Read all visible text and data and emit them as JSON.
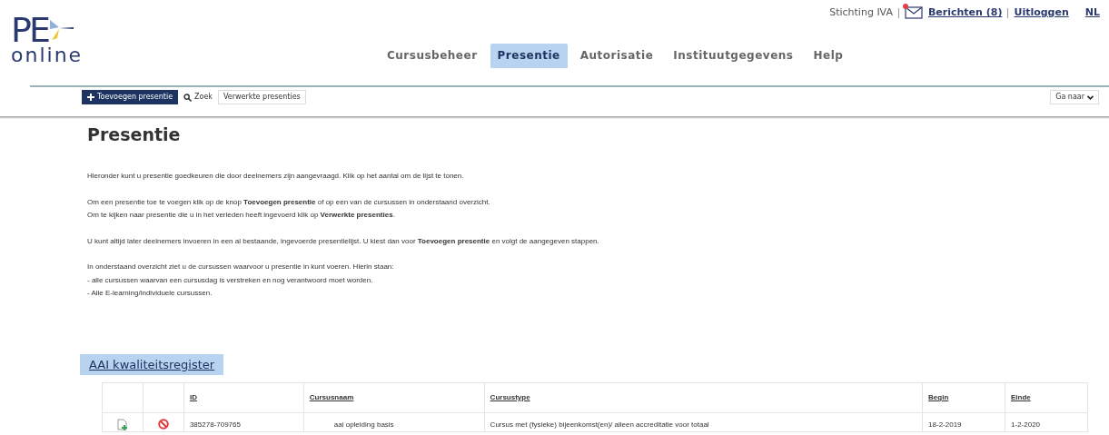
{
  "logo": {
    "mark": "PE",
    "word": "online"
  },
  "user_bar": {
    "organisation": "Stichting IVA",
    "messages": "Berichten (8)",
    "logout": "Uitloggen",
    "language": "NL"
  },
  "nav": [
    {
      "label": "Cursusbeheer",
      "selected": false
    },
    {
      "label": "Presentie",
      "selected": true
    },
    {
      "label": "Autorisatie",
      "selected": false
    },
    {
      "label": "Instituutgegevens",
      "selected": false
    },
    {
      "label": "Help",
      "selected": false
    }
  ],
  "toolbar": [
    {
      "label": "Toevoegen presentie",
      "kind": "primary"
    },
    {
      "label": "Zoek",
      "kind": "search"
    },
    {
      "label": "Verwerkte presenties",
      "kind": "plain"
    }
  ],
  "goto_menu": "Ga naar",
  "heading": "Presentie",
  "paragraphs": [
    [
      "Hieronder kunt u presentie goedkeuren die door deelnemers zijn aangevraagd. Klik op het aantal om de lijst te tonen."
    ],
    [
      "Om een presentie toe te voegen klik op de knop **Toevoegen presentie** of op een van de cursussen in onderstaand overzicht.",
      "Om te kijken naar presentie die u in het verleden heeft ingevoerd klik op **Verwerkte presenties**."
    ],
    [
      "U kunt altijd later deelnemers invoeren in een al bestaande, ingevoerde presentielijst. U kiest dan voor **Toevoegen presentie** en volgt de aangegeven stappen."
    ],
    [
      "In onderstaand overzicht ziet u de cursussen waarvoor u presentie in kunt voeren. Hierin staan:",
      "- alle cursussen waarvan een cursusdag is verstreken en nog verantwoord moet worden.",
      "- Alle E-learning/individuele cursussen."
    ]
  ],
  "register": {
    "title": "AAI kwaliteitsregister",
    "columns": [
      "ID",
      "Cursusnaam",
      "Cursustype",
      "Begin",
      "Einde"
    ],
    "rows": [
      {
        "id": "385278-709765",
        "name": "aai opleiding basis",
        "type": "Cursus met (fysieke) bijeenkomst(en)/ alleen accreditatie voor totaal",
        "begin": "18-2-2019",
        "end": "1-2-2020"
      }
    ]
  }
}
